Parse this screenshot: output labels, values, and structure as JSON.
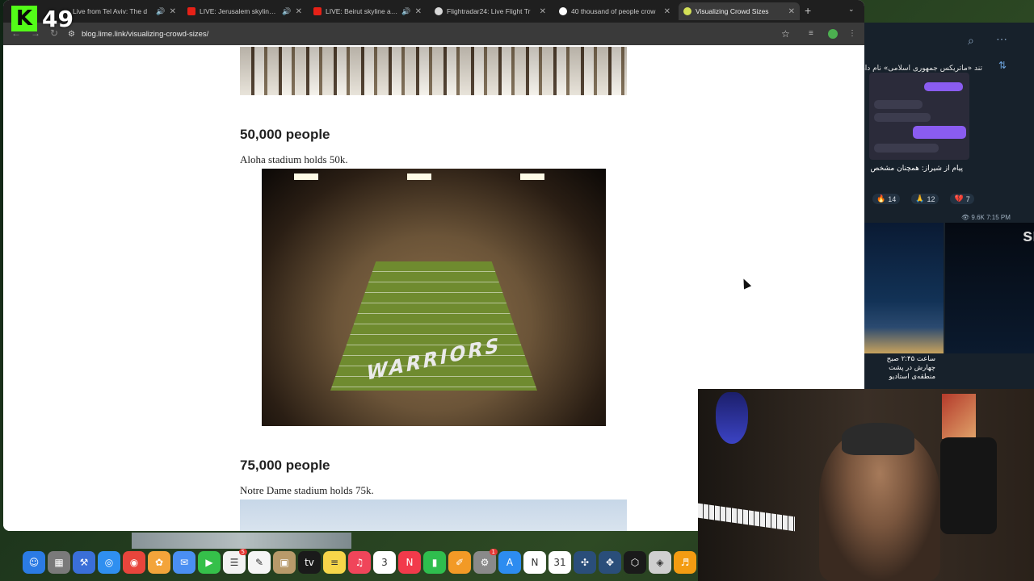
{
  "overlay": {
    "viewer_count": "49",
    "kick_logo": "K"
  },
  "browser": {
    "tabs": [
      {
        "title": "Live from Tel Aviv: The d",
        "icon": "youtube-icon",
        "audio": true
      },
      {
        "title": "LIVE: Jerusalem skyline as I",
        "icon": "youtube-icon",
        "audio": true
      },
      {
        "title": "LIVE: Beirut skyline as Is",
        "icon": "youtube-icon",
        "audio": true
      },
      {
        "title": "Flightradar24: Live Flight Tr",
        "icon": "flightradar-icon",
        "audio": false
      },
      {
        "title": "40 thousand of people crow",
        "icon": "google-icon",
        "audio": false
      },
      {
        "title": "Visualizing Crowd Sizes",
        "icon": "lime-icon",
        "audio": false,
        "active": true
      }
    ],
    "new_tab": "+",
    "url": "blog.lime.link/visualizing-crowd-sizes/"
  },
  "article": {
    "sections": [
      {
        "heading": "50,000 people",
        "caption": "Aloha stadium holds 50k."
      },
      {
        "heading": "75,000 people",
        "caption": "Notre Dame stadium holds 75k."
      }
    ],
    "endzone_text": "WARRIORS"
  },
  "social_panel": {
    "channel_title": "تند «ماتریکس جمهوری اسلامی» نام دار",
    "post_text": "پیام از شیراز: همچنان مشخص ",
    "reactions": [
      {
        "emoji": "🔥",
        "count": "14"
      },
      {
        "emoji": "🙏",
        "count": "12"
      },
      {
        "emoji": "💔",
        "count": "7"
      }
    ],
    "views_time": "9.6K 7:15 PM",
    "side_photo_text": "sr",
    "caption": "ساعت ۲:۴۵ صبح چهارش در پشت منطقه‌ی استادیو"
  },
  "dock": {
    "apps": [
      {
        "name": "finder-icon",
        "color": "#2b7be4",
        "glyph": "☺"
      },
      {
        "name": "launchpad-icon",
        "color": "#7a7a7a",
        "glyph": "▦"
      },
      {
        "name": "xcode-icon",
        "color": "#3a6fd8",
        "glyph": "⚒"
      },
      {
        "name": "safari-icon",
        "color": "#2f8ff0",
        "glyph": "◎"
      },
      {
        "name": "chrome-icon",
        "color": "#e8453c",
        "glyph": "◉"
      },
      {
        "name": "photos-icon",
        "color": "#f3a43a",
        "glyph": "✿"
      },
      {
        "name": "mail-icon",
        "color": "#4a8ff2",
        "glyph": "✉"
      },
      {
        "name": "facetime-icon",
        "color": "#35c04a",
        "glyph": "▶"
      },
      {
        "name": "reminders-icon",
        "color": "#f2f2f2",
        "glyph": "☰",
        "badge": "5"
      },
      {
        "name": "freeform-icon",
        "color": "#f5f5f5",
        "glyph": "✎"
      },
      {
        "name": "archive-icon",
        "color": "#b89a6a",
        "glyph": "▣"
      },
      {
        "name": "appletv-icon",
        "color": "#1a1a1a",
        "glyph": "tv"
      },
      {
        "name": "notes-icon",
        "color": "#f6d64a",
        "glyph": "≡"
      },
      {
        "name": "music-icon",
        "color": "#f0455a",
        "glyph": "♫"
      },
      {
        "name": "calendar-icon",
        "color": "#ffffff",
        "glyph": "3"
      },
      {
        "name": "news-icon",
        "color": "#f23a4b",
        "glyph": "N"
      },
      {
        "name": "numbers-icon",
        "color": "#2fbe4e",
        "glyph": "▮"
      },
      {
        "name": "pages-icon",
        "color": "#f29a26",
        "glyph": "✐"
      },
      {
        "name": "system-settings-icon",
        "color": "#8a8a8a",
        "glyph": "⚙",
        "badge": "1"
      },
      {
        "name": "app-store-icon",
        "color": "#2d8cf0",
        "glyph": "A"
      },
      {
        "name": "notion-icon",
        "color": "#ffffff",
        "glyph": "N"
      },
      {
        "name": "calendar-31-icon",
        "color": "#ffffff",
        "glyph": "31"
      },
      {
        "name": "network-icon",
        "color": "#2a4e7a",
        "glyph": "✣"
      },
      {
        "name": "vpn-icon",
        "color": "#2a4e7a",
        "glyph": "✥"
      },
      {
        "name": "unity-icon",
        "color": "#1a1a1a",
        "glyph": "⬡"
      },
      {
        "name": "screenshot-icon",
        "color": "#cfcfcf",
        "glyph": "◈"
      },
      {
        "name": "fl-studio-icon",
        "color": "#f39c12",
        "glyph": "♬"
      }
    ]
  }
}
